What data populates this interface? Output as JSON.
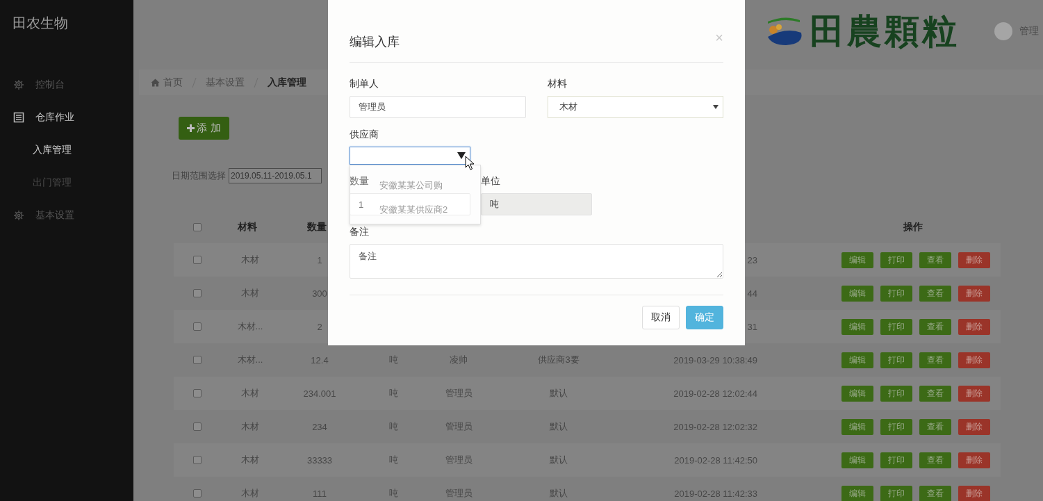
{
  "sidebar": {
    "brand": "田农生物",
    "items": [
      {
        "label": "控制台",
        "kind": "gear",
        "selected": false
      },
      {
        "label": "仓库作业",
        "kind": "document",
        "selected": true,
        "children": [
          {
            "label": "入库管理",
            "selected": true
          },
          {
            "label": "出门管理",
            "selected": false
          }
        ]
      },
      {
        "label": "基本设置",
        "kind": "gear",
        "selected": false
      }
    ]
  },
  "header": {
    "logo_text": "田農顆粒",
    "user": "管理"
  },
  "breadcrumb": [
    {
      "label": "首页",
      "kind": "home",
      "selected": false
    },
    {
      "label": "基本设置",
      "kind": "link",
      "selected": false
    },
    {
      "label": "入库管理",
      "kind": "link",
      "selected": true
    }
  ],
  "add_button": "添 加",
  "date_filter": {
    "label": "日期范围选择",
    "value": "2019.05.11-2019.05.1"
  },
  "table": {
    "header_checked": false,
    "columns": [
      "材料",
      "数量",
      "操作"
    ],
    "rows": [
      {
        "checked": false,
        "material": "木材",
        "quantity": "1",
        "date": "23",
        "actions": [
          {
            "label": "编辑",
            "kind": "primary"
          },
          {
            "label": "打印",
            "kind": "primary"
          },
          {
            "label": "查看",
            "kind": "primary"
          },
          {
            "label": "删除",
            "kind": "danger"
          }
        ]
      },
      {
        "checked": false,
        "material": "木材",
        "quantity": "300",
        "date": "44",
        "actions": [
          {
            "label": "编辑",
            "kind": "primary"
          },
          {
            "label": "打印",
            "kind": "primary"
          },
          {
            "label": "查看",
            "kind": "primary"
          },
          {
            "label": "删除",
            "kind": "danger"
          }
        ]
      },
      {
        "checked": false,
        "material": "木材...",
        "quantity": "2",
        "date": "31",
        "actions": [
          {
            "label": "编辑",
            "kind": "primary"
          },
          {
            "label": "打印",
            "kind": "primary"
          },
          {
            "label": "查看",
            "kind": "primary"
          },
          {
            "label": "删除",
            "kind": "danger"
          }
        ]
      },
      {
        "checked": false,
        "material": "木材...",
        "quantity": "12.4",
        "unit": "吨",
        "maker": "凌帅",
        "supplier": "供应商3要",
        "date": "2019-03-29 10:38:49",
        "actions": [
          {
            "label": "编辑",
            "kind": "primary"
          },
          {
            "label": "打印",
            "kind": "primary"
          },
          {
            "label": "查看",
            "kind": "primary"
          },
          {
            "label": "删除",
            "kind": "danger"
          }
        ]
      },
      {
        "checked": false,
        "material": "木材",
        "quantity": "234.001",
        "unit": "吨",
        "maker": "管理员",
        "supplier": "默认",
        "date": "2019-02-28 12:02:44",
        "actions": [
          {
            "label": "编辑",
            "kind": "primary"
          },
          {
            "label": "打印",
            "kind": "primary"
          },
          {
            "label": "查看",
            "kind": "primary"
          },
          {
            "label": "删除",
            "kind": "danger"
          }
        ]
      },
      {
        "checked": false,
        "material": "木材",
        "quantity": "234",
        "unit": "吨",
        "maker": "管理员",
        "supplier": "默认",
        "date": "2019-02-28 12:02:32",
        "actions": [
          {
            "label": "编辑",
            "kind": "primary"
          },
          {
            "label": "打印",
            "kind": "primary"
          },
          {
            "label": "查看",
            "kind": "primary"
          },
          {
            "label": "删除",
            "kind": "danger"
          }
        ]
      },
      {
        "checked": false,
        "material": "木材",
        "quantity": "33333",
        "unit": "吨",
        "maker": "管理员",
        "supplier": "默认",
        "date": "2019-02-28 11:42:50",
        "actions": [
          {
            "label": "编辑",
            "kind": "primary"
          },
          {
            "label": "打印",
            "kind": "primary"
          },
          {
            "label": "查看",
            "kind": "primary"
          },
          {
            "label": "删除",
            "kind": "danger"
          }
        ]
      },
      {
        "checked": false,
        "material": "木材",
        "quantity": "111",
        "unit": "吨",
        "maker": "管理员",
        "supplier": "默认",
        "date": "2019-02-28 11:42:33",
        "actions": [
          {
            "label": "编辑",
            "kind": "primary"
          },
          {
            "label": "打印",
            "kind": "primary"
          },
          {
            "label": "查看",
            "kind": "primary"
          },
          {
            "label": "删除",
            "kind": "danger"
          }
        ]
      }
    ]
  },
  "modal": {
    "title": "编辑入库",
    "close": "×",
    "fields": [
      {
        "label": "制单人",
        "kind": "text",
        "value": "管理员"
      },
      {
        "label": "材料",
        "kind": "select",
        "value": "木材",
        "focused": false
      },
      {
        "label": "供应商",
        "kind": "select",
        "focused": true,
        "expanded": true,
        "options": [
          "安徽某某公司购",
          "安徽某某供应商2"
        ]
      },
      {
        "label": "数量",
        "kind": "text",
        "value": "1"
      },
      {
        "label": "单位",
        "kind": "text",
        "value": "吨",
        "disabled": true
      },
      {
        "label": "备注",
        "kind": "textarea",
        "placeholder": "备注"
      }
    ],
    "buttons": [
      {
        "label": "取消",
        "kind": "default"
      },
      {
        "label": "确定",
        "kind": "primary"
      }
    ]
  }
}
